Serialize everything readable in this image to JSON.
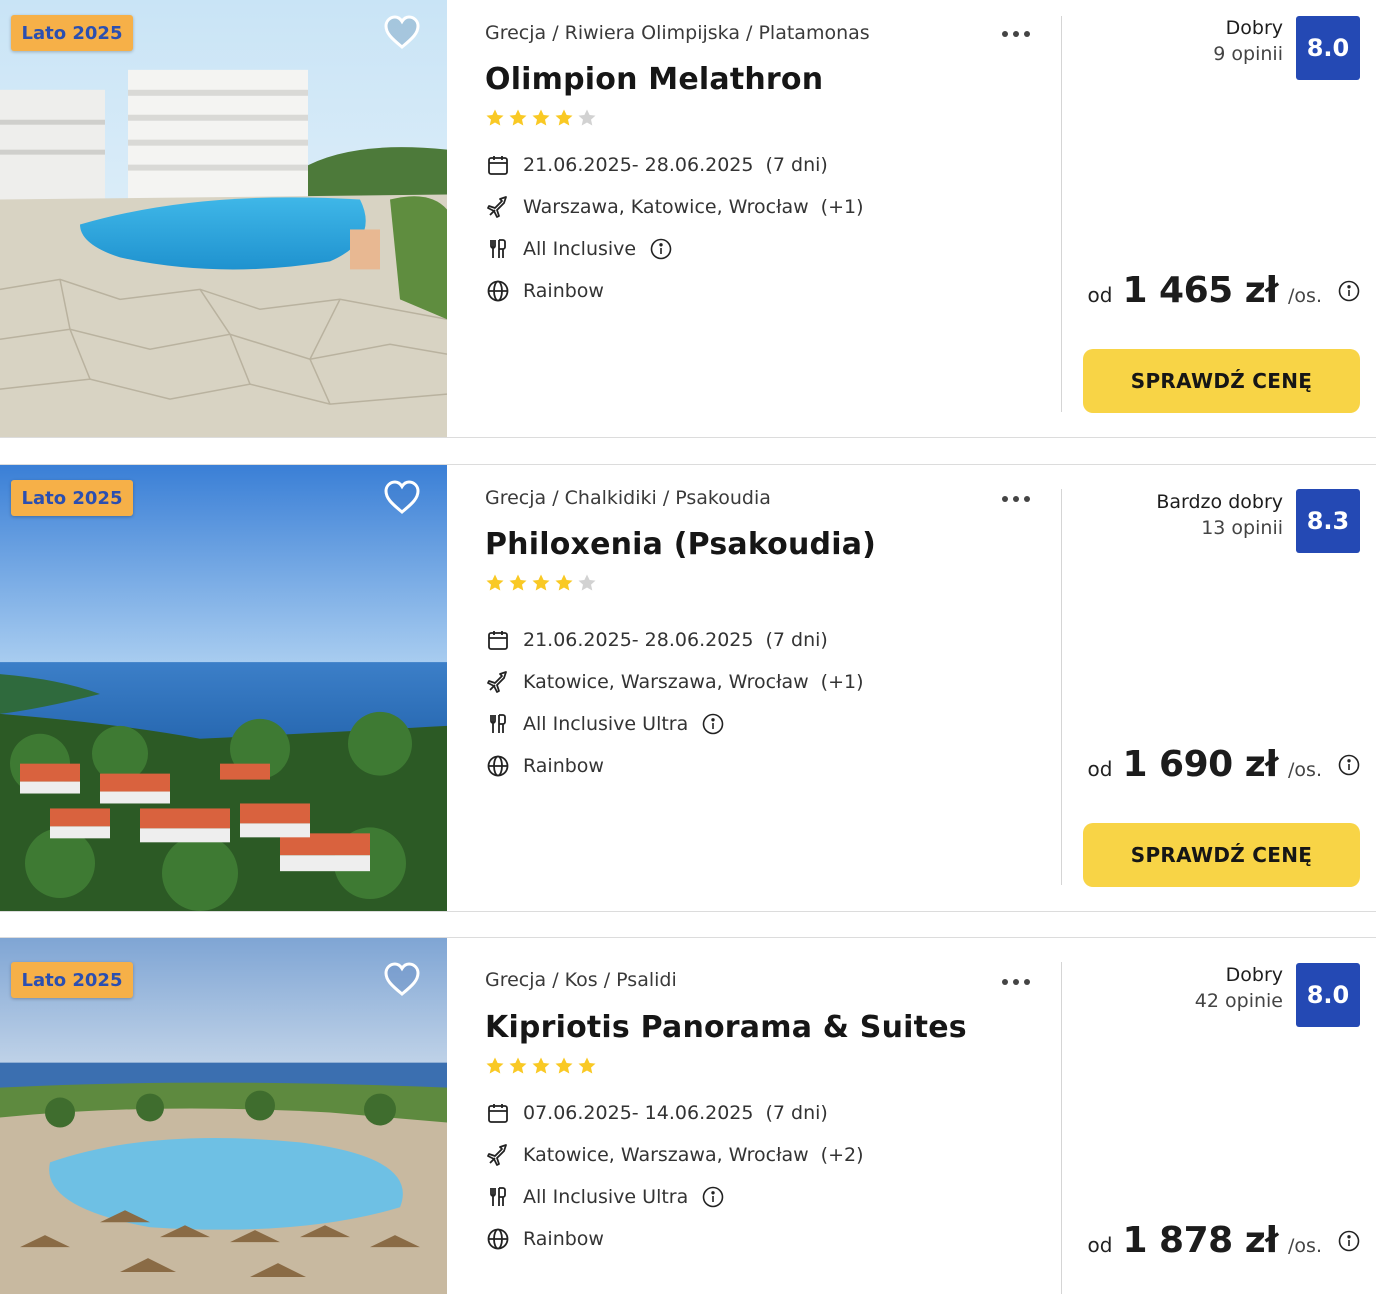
{
  "colors": {
    "badge": "#f6b048",
    "badge_text": "#2b4fb0",
    "score_bg": "#2449b4",
    "cta": "#f8d446",
    "star": "#f9c924",
    "star_empty": "#d2d2d2"
  },
  "offers": [
    {
      "badge": "Lato 2025",
      "breadcrumb": "Grecja / Riwiera Olimpijska / Platamonas",
      "name": "Olimpion Melathron",
      "stars": 4,
      "dates": "21.06.2025- 28.06.2025",
      "duration": "(7 dni)",
      "departures": "Warszawa, Katowice, Wrocław",
      "departures_extra": "(+1)",
      "board": "All Inclusive",
      "operator": "Rainbow",
      "rating_word": "Dobry",
      "rating_count": "9 opinii",
      "score": "8.0",
      "price_prefix": "od",
      "price": "1 465 zł",
      "price_unit": "/os.",
      "cta": "SPRAWDŹ CENĘ",
      "photo": "hotel-pool-photo"
    },
    {
      "badge": "Lato 2025",
      "breadcrumb": "Grecja / Chalkidiki / Psakoudia",
      "name": "Philoxenia (Psakoudia)",
      "stars": 4,
      "dates": "21.06.2025- 28.06.2025",
      "duration": "(7 dni)",
      "departures": "Katowice, Warszawa, Wrocław",
      "departures_extra": "(+1)",
      "board": "All Inclusive Ultra",
      "operator": "Rainbow",
      "rating_word": "Bardzo dobry",
      "rating_count": "13 opinii",
      "score": "8.3",
      "price_prefix": "od",
      "price": "1 690 zł",
      "price_unit": "/os.",
      "cta": "SPRAWDŹ CENĘ",
      "photo": "sea-resort-aerial-photo"
    },
    {
      "badge": "Lato 2025",
      "breadcrumb": "Grecja / Kos / Psalidi",
      "name": "Kipriotis Panorama & Suites",
      "stars": 5,
      "dates": "07.06.2025- 14.06.2025",
      "duration": "(7 dni)",
      "departures": "Katowice, Warszawa, Wrocław",
      "departures_extra": "(+2)",
      "board": "All Inclusive Ultra",
      "operator": "Rainbow",
      "rating_word": "Dobry",
      "rating_count": "42 opinie",
      "score": "8.0",
      "price_prefix": "od",
      "price": "1 878 zł",
      "price_unit": "/os.",
      "photo": "pool-umbrellas-photo"
    }
  ]
}
